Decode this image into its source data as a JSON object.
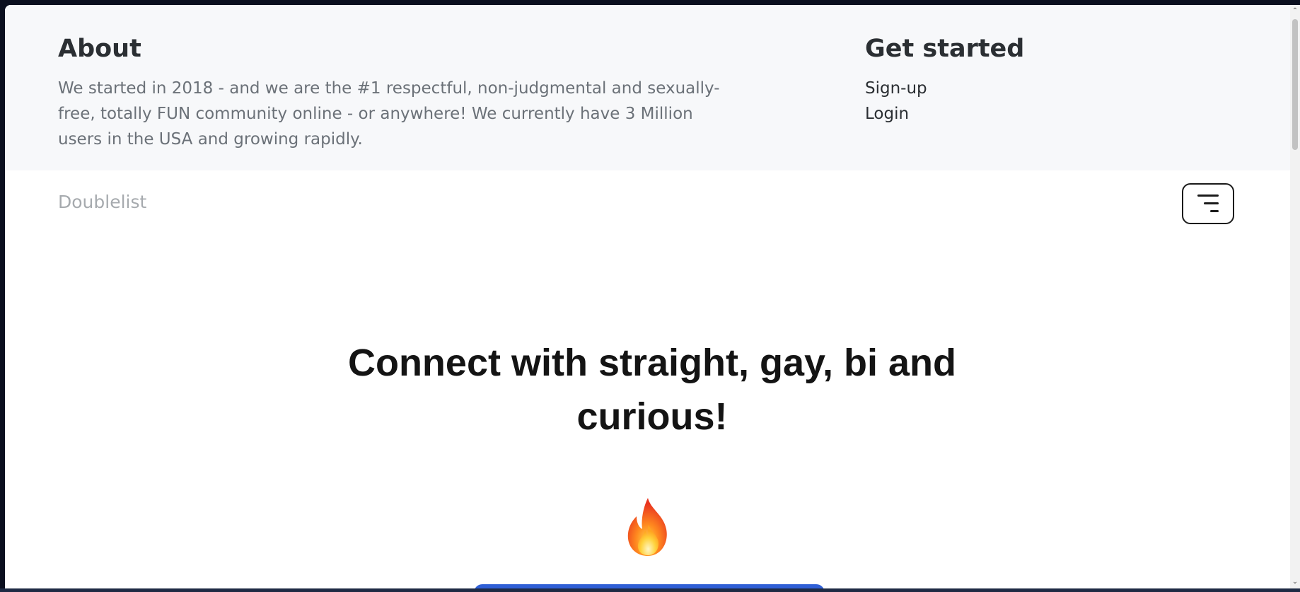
{
  "about": {
    "title": "About",
    "text": "We started in 2018 - and we are the #1 respectful, non-judgmental and sexually-free, totally FUN community online - or anywhere! We currently have 3 Million users in the USA and growing rapidly."
  },
  "get_started": {
    "title": "Get started",
    "links": [
      {
        "label": "Sign-up"
      },
      {
        "label": "Login"
      }
    ]
  },
  "navbar": {
    "brand": "Doublelist",
    "menu_icon": "menu-lines-icon"
  },
  "hero": {
    "title": "Connect with straight, gay, bi and curious!",
    "icon": "fire-icon"
  },
  "colors": {
    "panel_bg": "#f7f8fa",
    "cta": "#2f5fd6",
    "brand_text": "#a6aaae"
  },
  "scrollbar": {
    "up_icon": "chevron-up-icon",
    "down_icon": "chevron-down-icon"
  }
}
